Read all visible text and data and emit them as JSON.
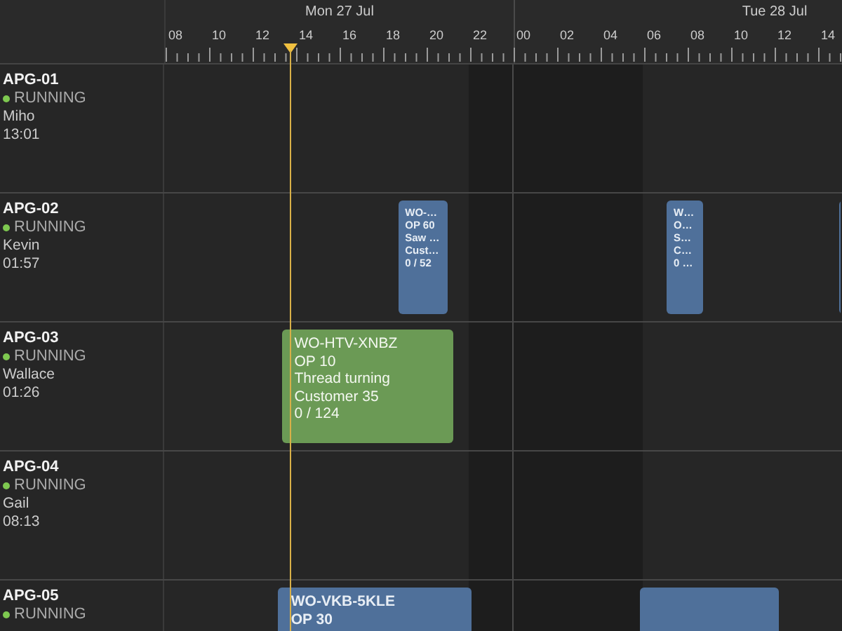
{
  "timeline": {
    "days": [
      {
        "label": "Mon 27 Jul"
      },
      {
        "label": "Tue 28 Jul"
      }
    ],
    "hour_labels": [
      "08",
      "10",
      "12",
      "14",
      "16",
      "18",
      "20",
      "22",
      "00",
      "02",
      "04",
      "06",
      "08",
      "10",
      "12",
      "14"
    ]
  },
  "resources": [
    {
      "name": "APG-01",
      "status": "RUNNING",
      "color": "#7ec850",
      "operator": "Miho",
      "time": "13:01"
    },
    {
      "name": "APG-02",
      "status": "RUNNING",
      "color": "#7ec850",
      "operator": "Kevin",
      "time": "01:57",
      "events": [
        {
          "kind": "job",
          "lines": [
            "WO-…",
            "OP 60",
            "Saw …",
            "Cust…",
            "0 / 52"
          ]
        },
        {
          "kind": "job",
          "lines": [
            "W…",
            "O…",
            "S…",
            "C…",
            "0 …"
          ]
        },
        {
          "kind": "job"
        }
      ]
    },
    {
      "name": "APG-03",
      "status": "RUNNING",
      "color": "#7ec850",
      "operator": "Wallace",
      "time": "01:26",
      "events": [
        {
          "kind": "active",
          "lines": [
            "WO-HTV-XNBZ",
            "OP 10",
            "Thread turning",
            "Customer 35",
            "0 / 124"
          ]
        }
      ]
    },
    {
      "name": "APG-04",
      "status": "RUNNING",
      "color": "#7ec850",
      "operator": "Gail",
      "time": "08:13"
    },
    {
      "name": "APG-05",
      "status": "RUNNING",
      "color": "#7ec850",
      "events": [
        {
          "kind": "job",
          "lines": [
            "WO-VKB-5KLE",
            "OP 30"
          ]
        },
        {
          "kind": "job"
        }
      ]
    }
  ]
}
